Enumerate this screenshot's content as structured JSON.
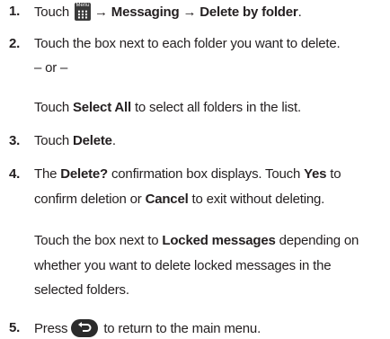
{
  "steps": {
    "s1": {
      "num": "1.",
      "pre": "Touch",
      "icon": "menu-icon",
      "icon_caption": "Menu",
      "path": "→ Messaging → Delete by folder",
      "end": "."
    },
    "s2": {
      "num": "2.",
      "line1": "Touch the box next to each folder you want to delete.",
      "or": "– or –",
      "pre": "Touch ",
      "bold": "Select All",
      "post": " to select all folders in the list."
    },
    "s3": {
      "num": "3.",
      "pre": "Touch ",
      "bold": "Delete",
      "post": "."
    },
    "s4": {
      "num": "4.",
      "a_pre": "The ",
      "a_bold": "Delete?",
      "a_mid": " confirmation box displays. Touch ",
      "a_bold2": "Yes",
      "a_post": " to",
      "b_pre": "confirm deletion or ",
      "b_bold": "Cancel",
      "b_post": " to exit without deleting.",
      "c_pre": "Touch the box next to ",
      "c_bold": "Locked messages",
      "c_post": " depending on",
      "d": "whether you want to delete locked messages in the",
      "e": "selected folders."
    },
    "s5": {
      "num": "5.",
      "pre": "Press",
      "icon": "back-icon",
      "post": "to return to the main menu."
    }
  }
}
